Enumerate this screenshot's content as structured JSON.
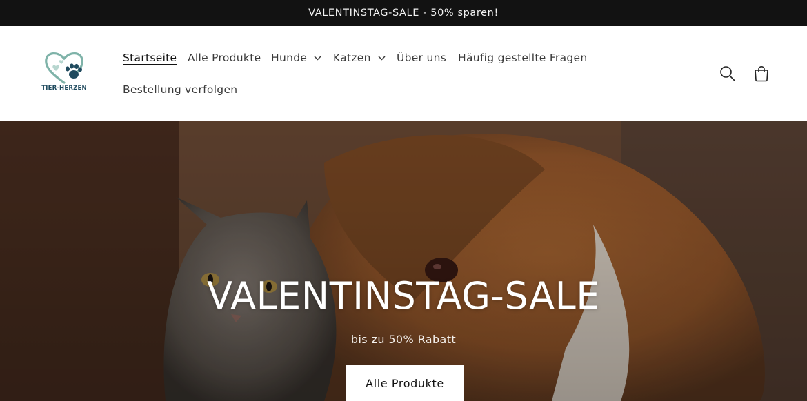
{
  "announcement": {
    "text": "VALENTINSTAG-SALE - 50% sparen!"
  },
  "logo": {
    "text": "TIER-HERZEN",
    "colors": {
      "heart": "#7fb3a9",
      "paw": "#1f4a5e"
    }
  },
  "nav": {
    "items": [
      {
        "label": "Startseite",
        "active": true
      },
      {
        "label": "Alle Produkte"
      },
      {
        "label": "Hunde",
        "has_dropdown": true
      },
      {
        "label": "Katzen",
        "has_dropdown": true
      },
      {
        "label": "Über uns"
      },
      {
        "label": "Häufig gestellte Fragen"
      },
      {
        "label": "Bestellung verfolgen"
      }
    ]
  },
  "header_icons": {
    "search": "search-icon",
    "cart": "cart-icon"
  },
  "hero": {
    "title": "VALENTINSTAG-SALE",
    "subtitle": "bis zu 50% Rabatt",
    "button_label": "Alle Produkte"
  },
  "colors": {
    "announcement_bg": "#121212",
    "text_dark": "#121212",
    "button_bg": "#ffffff"
  }
}
